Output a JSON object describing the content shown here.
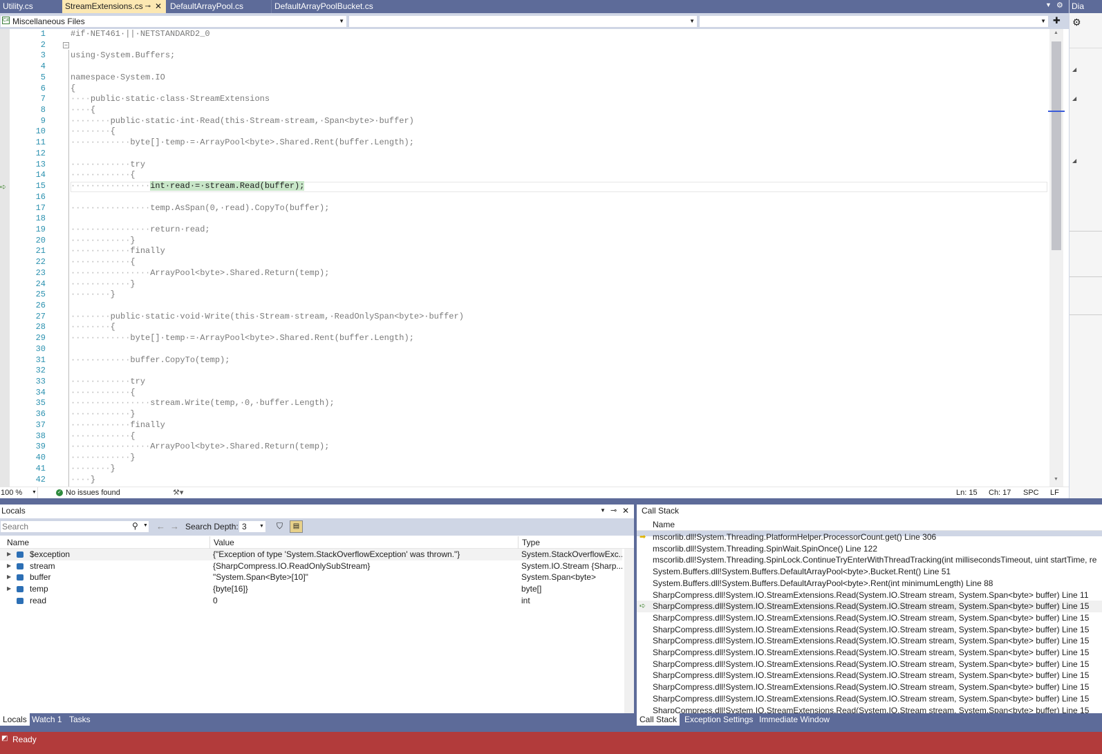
{
  "tabs": [
    {
      "label": "Utility.cs"
    },
    {
      "label": "StreamExtensions.cs",
      "pin": "⊸",
      "close": "✕"
    },
    {
      "label": "DefaultArrayPool.cs"
    },
    {
      "label": "DefaultArrayPoolBucket.cs"
    }
  ],
  "right_panel_label": "Dia",
  "navbar": {
    "project": "Miscellaneous Files"
  },
  "editor": {
    "lines": [
      "#if NET461 || NETSTANDARD2_0",
      "",
      "using System.Buffers;",
      "",
      "namespace System.IO",
      "{",
      "    public static class StreamExtensions",
      "    {",
      "        public static int Read(this Stream stream, Span<byte> buffer)",
      "        {",
      "            byte[] temp = ArrayPool<byte>.Shared.Rent(buffer.Length);",
      "",
      "            try",
      "            {",
      "                int read = stream.Read(buffer);",
      "",
      "                temp.AsSpan(0, read).CopyTo(buffer);",
      "",
      "                return read;",
      "            }",
      "            finally",
      "            {",
      "                ArrayPool<byte>.Shared.Return(temp);",
      "            }",
      "        }",
      "",
      "        public static void Write(this Stream stream, ReadOnlySpan<byte> buffer)",
      "        {",
      "            byte[] temp = ArrayPool<byte>.Shared.Rent(buffer.Length);",
      "",
      "            buffer.CopyTo(temp);",
      "",
      "            try",
      "            {",
      "                stream.Write(temp, 0, buffer.Length);",
      "            }",
      "            finally",
      "            {",
      "                ArrayPool<byte>.Shared.Return(temp);",
      "            }",
      "        }",
      "    }"
    ],
    "current_line": 15
  },
  "status": {
    "zoom": "100 %",
    "issues": "No issues found",
    "ln": "Ln: 15",
    "ch": "Ch: 17",
    "spc": "SPC",
    "lf": "LF"
  },
  "locals": {
    "title": "Locals",
    "search_placeholder": "Search",
    "search_depth_label": "Search Depth:",
    "search_depth_value": "3",
    "columns": [
      "Name",
      "Value",
      "Type"
    ],
    "rows": [
      {
        "name": "$exception",
        "value": "{\"Exception of type 'System.StackOverflowException' was thrown.\"}",
        "type": "System.StackOverflowExc..."
      },
      {
        "name": "stream",
        "value": "{SharpCompress.IO.ReadOnlySubStream}",
        "type": "System.IO.Stream {Sharp..."
      },
      {
        "name": "buffer",
        "value": "\"System.Span<Byte>[10]\"",
        "type": "System.Span<byte>"
      },
      {
        "name": "temp",
        "value": "{byte[16]}",
        "type": "byte[]"
      },
      {
        "name": "read",
        "value": "0",
        "type": "int"
      }
    ],
    "bottom_tabs": [
      "Locals",
      "Watch 1",
      "Tasks"
    ]
  },
  "callstack": {
    "title": "Call Stack",
    "column": "Name",
    "rows": [
      "mscorlib.dll!System.Threading.PlatformHelper.ProcessorCount.get() Line 306",
      "mscorlib.dll!System.Threading.SpinWait.SpinOnce() Line 122",
      "mscorlib.dll!System.Threading.SpinLock.ContinueTryEnterWithThreadTracking(int millisecondsTimeout, uint startTime, re",
      "System.Buffers.dll!System.Buffers.DefaultArrayPool<byte>.Bucket.Rent() Line 51",
      "System.Buffers.dll!System.Buffers.DefaultArrayPool<byte>.Rent(int minimumLength) Line 88",
      "SharpCompress.dll!System.IO.StreamExtensions.Read(System.IO.Stream stream, System.Span<byte> buffer) Line 11",
      "SharpCompress.dll!System.IO.StreamExtensions.Read(System.IO.Stream stream, System.Span<byte> buffer) Line 15",
      "SharpCompress.dll!System.IO.StreamExtensions.Read(System.IO.Stream stream, System.Span<byte> buffer) Line 15",
      "SharpCompress.dll!System.IO.StreamExtensions.Read(System.IO.Stream stream, System.Span<byte> buffer) Line 15",
      "SharpCompress.dll!System.IO.StreamExtensions.Read(System.IO.Stream stream, System.Span<byte> buffer) Line 15",
      "SharpCompress.dll!System.IO.StreamExtensions.Read(System.IO.Stream stream, System.Span<byte> buffer) Line 15",
      "SharpCompress.dll!System.IO.StreamExtensions.Read(System.IO.Stream stream, System.Span<byte> buffer) Line 15",
      "SharpCompress.dll!System.IO.StreamExtensions.Read(System.IO.Stream stream, System.Span<byte> buffer) Line 15",
      "SharpCompress.dll!System.IO.StreamExtensions.Read(System.IO.Stream stream, System.Span<byte> buffer) Line 15",
      "SharpCompress.dll!System.IO.StreamExtensions.Read(System.IO.Stream stream, System.Span<byte> buffer) Line 15",
      "SharpCompress.dll!System.IO.StreamExtensions.Read(System.IO.Stream stream, System.Span<byte> buffer) Line 15",
      "SharpCompress.dll!System.IO.StreamExtensions.Read(System.IO.Stream stream, System.Span<byte> buffer) Line 15"
    ],
    "bottom_tabs": [
      "Call Stack",
      "Exception Settings",
      "Immediate Window"
    ]
  },
  "app_status": {
    "text": "Ready"
  },
  "colors": {
    "accent": "#5d6b99",
    "status_error": "#b23b3b",
    "active_tab": "#fce8b2",
    "line_number": "#2b91af"
  }
}
